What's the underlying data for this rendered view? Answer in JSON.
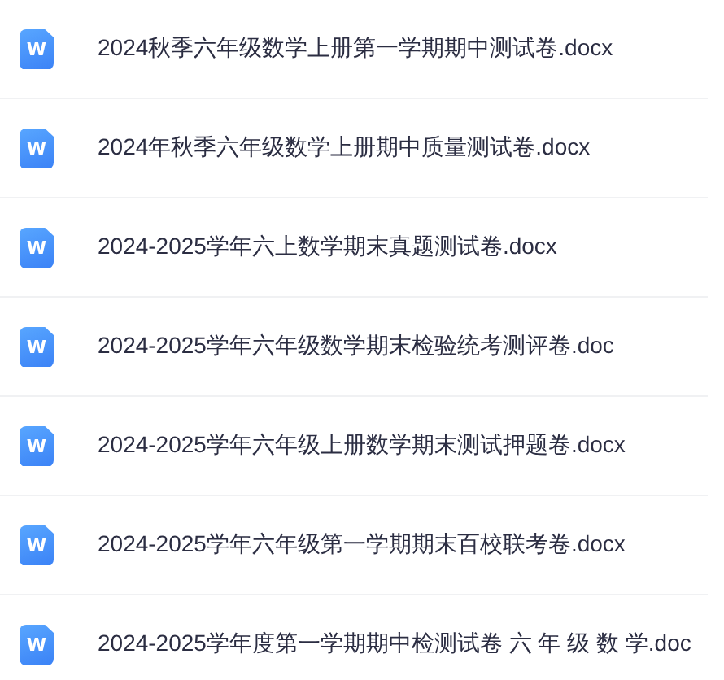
{
  "files": [
    {
      "icon_label": "W",
      "name": "2024秋季六年级数学上册第一学期期中测试卷.docx"
    },
    {
      "icon_label": "W",
      "name": "2024年秋季六年级数学上册期中质量测试卷.docx"
    },
    {
      "icon_label": "W",
      "name": "2024-2025学年六上数学期末真题测试卷.docx"
    },
    {
      "icon_label": "W",
      "name": "2024-2025学年六年级数学期末检验统考测评卷.doc"
    },
    {
      "icon_label": "W",
      "name": "2024-2025学年六年级上册数学期末测试押题卷.docx"
    },
    {
      "icon_label": "W",
      "name": "2024-2025学年六年级第一学期期末百校联考卷.docx"
    },
    {
      "icon_label": "W",
      "name": "2024-2025学年度第一学期期中检测试卷 六 年 级 数 学.doc"
    }
  ]
}
